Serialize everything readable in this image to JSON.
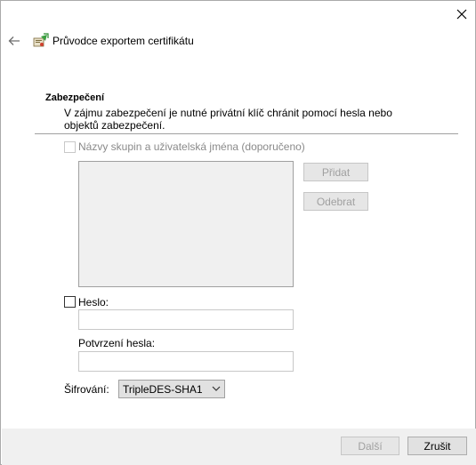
{
  "window": {
    "title": "Průvodce exportem certifikátu"
  },
  "section": {
    "heading": "Zabezpečení",
    "description": "V zájmu zabezpečení je nutné privátní klíč chránit pomocí hesla nebo objektů zabezpečení."
  },
  "groups": {
    "label": "Názvy skupin a uživatelská jména (doporučeno)",
    "checked": false,
    "enabled": false,
    "add_label": "Přidat",
    "remove_label": "Odebrat"
  },
  "password": {
    "label": "Heslo:",
    "checked": false,
    "value": "",
    "confirm_label": "Potvrzení hesla:",
    "confirm_value": ""
  },
  "encryption": {
    "label": "Šifrování:",
    "selected": "TripleDES-SHA1"
  },
  "footer": {
    "next_label": "Další",
    "cancel_label": "Zrušit"
  },
  "icons": {
    "close": "close-icon",
    "back": "back-arrow-icon",
    "wizard": "certificate-wizard-icon",
    "dropdown": "chevron-down-icon"
  }
}
